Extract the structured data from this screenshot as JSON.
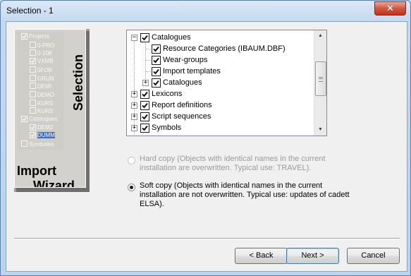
{
  "window": {
    "title": "Selection - 1",
    "close_glyph": "✕"
  },
  "graphic": {
    "tree_items": [
      {
        "label": "Projects",
        "checked": true,
        "selected": false
      },
      {
        "label": "0-PRO",
        "checked": false,
        "selected": false
      },
      {
        "label": "0-108",
        "checked": false,
        "selected": false
      },
      {
        "label": "VXMB",
        "checked": true,
        "selected": false
      },
      {
        "label": "0FOR",
        "checked": false,
        "selected": false
      },
      {
        "label": "GRUN",
        "checked": false,
        "selected": false
      },
      {
        "label": "DEMI",
        "checked": false,
        "selected": false
      },
      {
        "label": "DEMO",
        "checked": false,
        "selected": false
      },
      {
        "label": "KURS",
        "checked": false,
        "selected": false
      },
      {
        "label": "KURS",
        "checked": false,
        "selected": false
      },
      {
        "label": "Catalogues",
        "checked": true,
        "selected": false
      },
      {
        "label": "DEM2",
        "checked": true,
        "selected": false
      },
      {
        "label": "DUMM",
        "checked": true,
        "selected": true
      },
      {
        "label": "Symboles",
        "checked": false,
        "selected": false
      }
    ],
    "word_import": "Import",
    "word_wizard": "Wizard",
    "word_selection": "Selection"
  },
  "tree": {
    "items": [
      {
        "label": "Catalogues",
        "level": 0,
        "expander": "−",
        "checked": true
      },
      {
        "label": "Resource Categories (IBAUM.DBF)",
        "level": 1,
        "expander": "",
        "checked": true
      },
      {
        "label": "Wear-groups",
        "level": 1,
        "expander": "",
        "checked": true
      },
      {
        "label": "Import templates",
        "level": 1,
        "expander": "",
        "checked": true
      },
      {
        "label": "Catalogues",
        "level": 1,
        "expander": "+",
        "checked": true
      },
      {
        "label": "Lexicons",
        "level": 0,
        "expander": "+",
        "checked": true
      },
      {
        "label": "Report definitions",
        "level": 0,
        "expander": "+",
        "checked": true
      },
      {
        "label": "Script sequences",
        "level": 0,
        "expander": "+",
        "checked": true
      },
      {
        "label": "Symbols",
        "level": 0,
        "expander": "+",
        "checked": true
      }
    ],
    "scroll_up_glyph": "▲",
    "scroll_down_glyph": "▼"
  },
  "options": {
    "hard_copy": {
      "text": "Hard copy (Objects with identical names in the current installation are overwritten. Typical use: TRAVEL).",
      "selected": false,
      "enabled": false
    },
    "soft_copy": {
      "text": "Soft copy (Objects with identical names in the current installation are not overwritten. Typical use: updates of cadett ELSA).",
      "selected": true,
      "enabled": true
    }
  },
  "buttons": {
    "back": "< Back",
    "next": "Next >",
    "cancel": "Cancel"
  }
}
